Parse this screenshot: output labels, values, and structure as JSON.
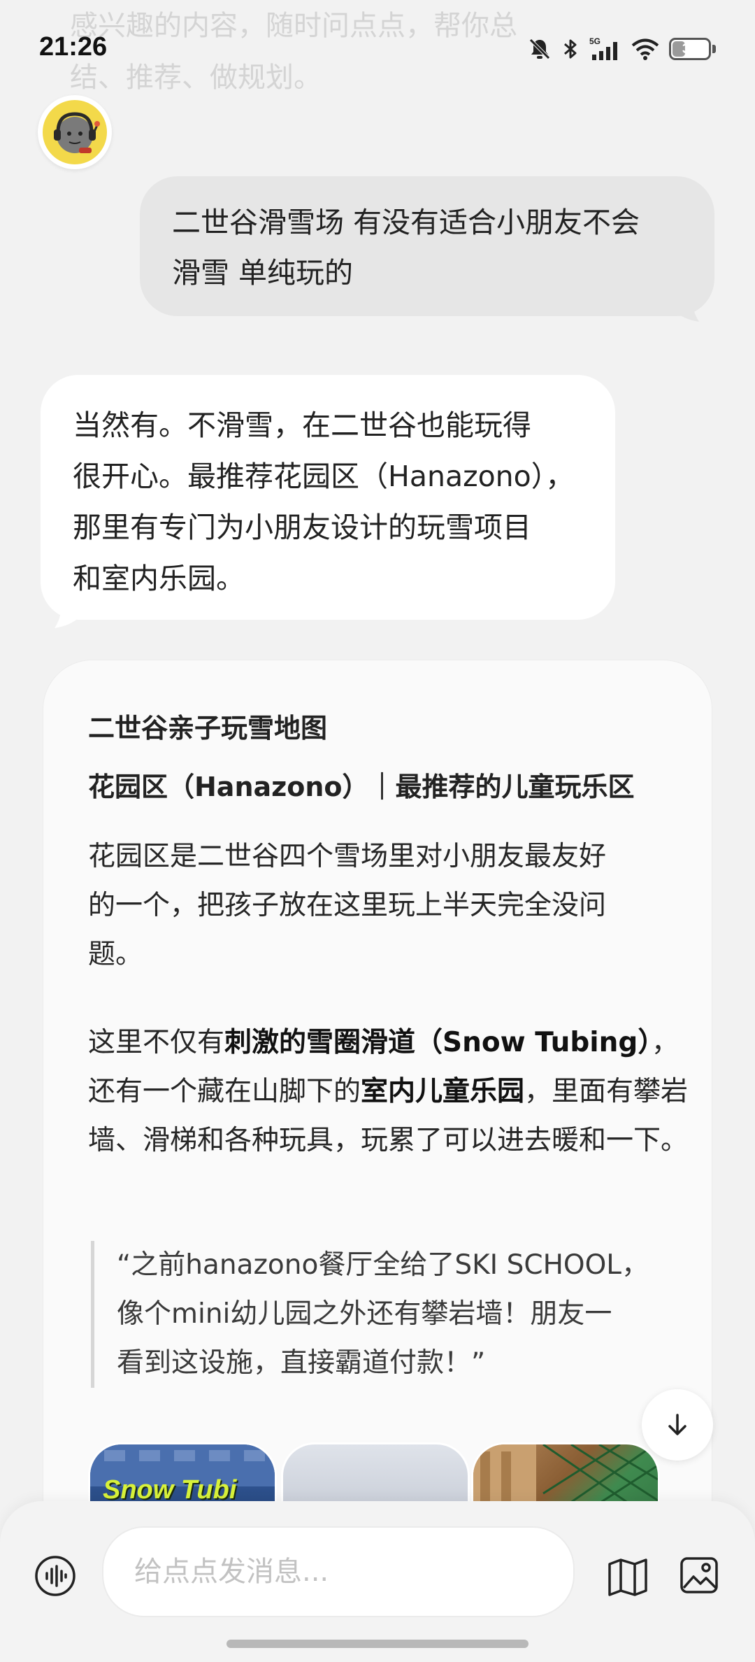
{
  "background_text": {
    "line1": "感兴趣的内容，随时问点点，帮你总",
    "line2": "结、推荐、做规划。"
  },
  "status_bar": {
    "time": "21:26",
    "network": "5G",
    "battery_level": "36",
    "icons": [
      "mute-icon",
      "bluetooth-icon",
      "signal-icon",
      "wifi-icon",
      "battery-icon"
    ]
  },
  "assistant": {
    "avatar_icon": "assistant-avatar-icon"
  },
  "messages": {
    "user": {
      "line1": "二世谷滑雪场 有没有适合小朋友不会",
      "line2": "滑雪 单纯玩的"
    },
    "bot": {
      "line1": "当然有。不滑雪，在二世谷也能玩得",
      "line2": "很开心。最推荐花园区（Hanazono），",
      "line3": "那里有专门为小朋友设计的玩雪项目",
      "line4": "和室内乐园。"
    }
  },
  "card": {
    "title": "二世谷亲子玩雪地图",
    "subtitle": "花园区（Hanazono）｜最推荐的儿童玩乐区",
    "p1_line1": "花园区是二世谷四个雪场里对小朋友最友好",
    "p1_line2": "的一个，把孩子放在这里玩上半天完全没问",
    "p1_line3": "题。",
    "p2_a": "这里不仅有",
    "p2_b_bold": "刺激的雪圈滑道（Snow Tubing）",
    "p2_c": "，还有一个藏在山脚下的",
    "p2_d_bold": "室内儿童乐园",
    "p2_e": "，里面有攀岩墙、滑梯和各种玩具，玩累了可以进去暖和一下。",
    "quote_line1": "“之前hanazono餐厅全给了SKI SCHOOL，",
    "quote_line2": "像个mini幼儿园之外还有攀岩墙！朋友一",
    "quote_line3": "看到这设施，直接霸道付款！”",
    "images": [
      {
        "caption": "Snow Tubi"
      },
      {
        "caption": ""
      },
      {
        "caption": ""
      }
    ]
  },
  "input": {
    "placeholder": "给点点发消息..."
  },
  "colors": {
    "background": "#f2f2f2",
    "user_bubble": "#e6e6e6",
    "bot_bubble": "#ffffff",
    "placeholder": "#c2c2c2"
  }
}
